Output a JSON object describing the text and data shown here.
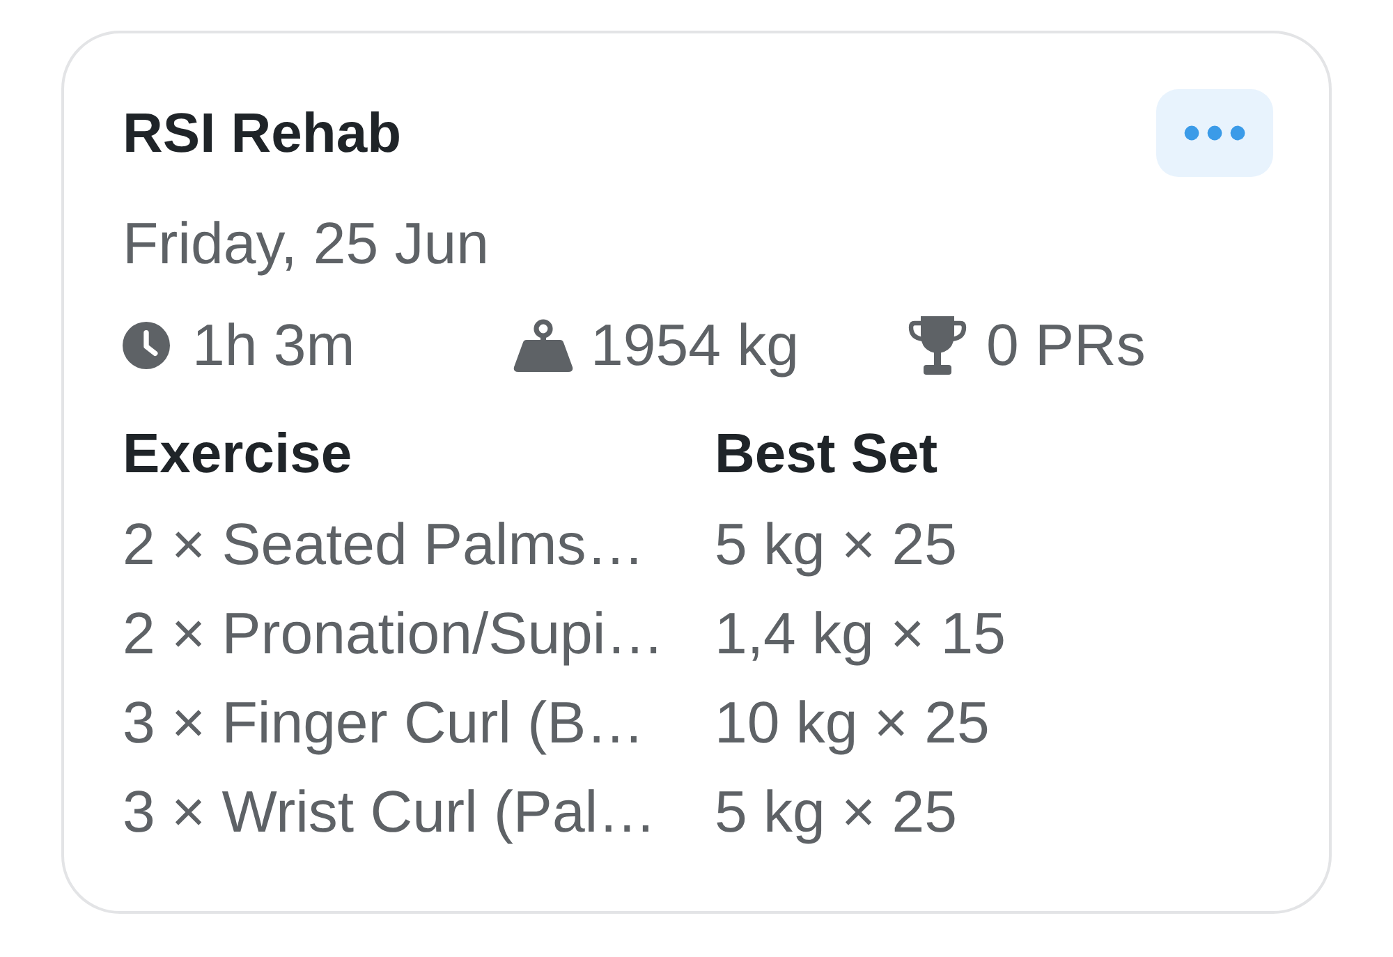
{
  "workout": {
    "title": "RSI Rehab",
    "date": "Friday, 25 Jun"
  },
  "stats": [
    {
      "kind": "duration",
      "value": "1h 3m"
    },
    {
      "kind": "volume",
      "value": "1954 kg"
    },
    {
      "kind": "records",
      "value": "0 PRs"
    }
  ],
  "table": {
    "columns": [
      "Exercise",
      "Best Set"
    ],
    "rows": [
      [
        "2 × Seated Palms…",
        "5 kg × 25"
      ],
      [
        "2 × Pronation/Supi…",
        "1,4 kg × 15"
      ],
      [
        "3 × Finger Curl (B…",
        "10 kg × 25"
      ],
      [
        "3 × Wrist Curl (Pal…",
        "5 kg × 25"
      ]
    ]
  }
}
